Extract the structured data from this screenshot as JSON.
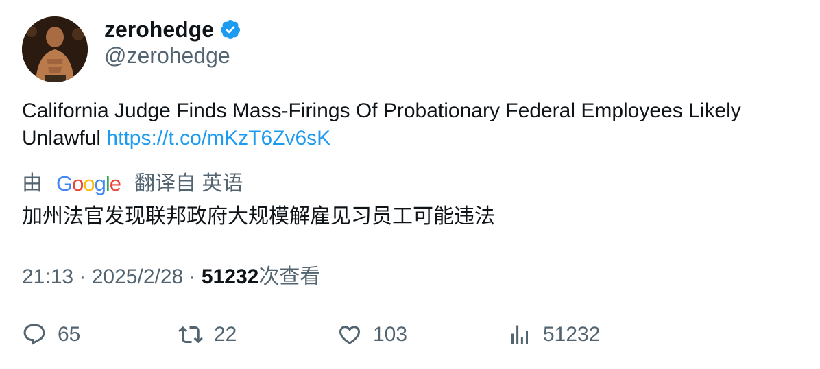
{
  "author": {
    "name": "zerohedge",
    "handle": "@zerohedge",
    "verified": true,
    "verified_color": "#1d9bf0"
  },
  "tweet": {
    "text": "California Judge Finds Mass-Firings Of Probationary Federal Employees Likely Unlawful",
    "link": "https://t.co/mKzT6Zv6sK",
    "link_color": "#1d9bf0"
  },
  "translation": {
    "prefix": "由",
    "provider_logo": "Google",
    "suffix": "翻译自 英语",
    "text": "加州法官发现联邦政府大规模解雇见习员工可能违法"
  },
  "meta": {
    "time": "21:13",
    "separator1": " · ",
    "date": "2025/2/28",
    "separator2": " · ",
    "views": "51232",
    "views_label": "次查看"
  },
  "actions": {
    "replies": "65",
    "retweets": "22",
    "likes": "103",
    "views": "51232"
  },
  "icons": {
    "reply": "reply-icon",
    "retweet": "retweet-icon",
    "like": "heart-icon",
    "views": "analytics-icon",
    "verified": "verified-badge-icon"
  }
}
